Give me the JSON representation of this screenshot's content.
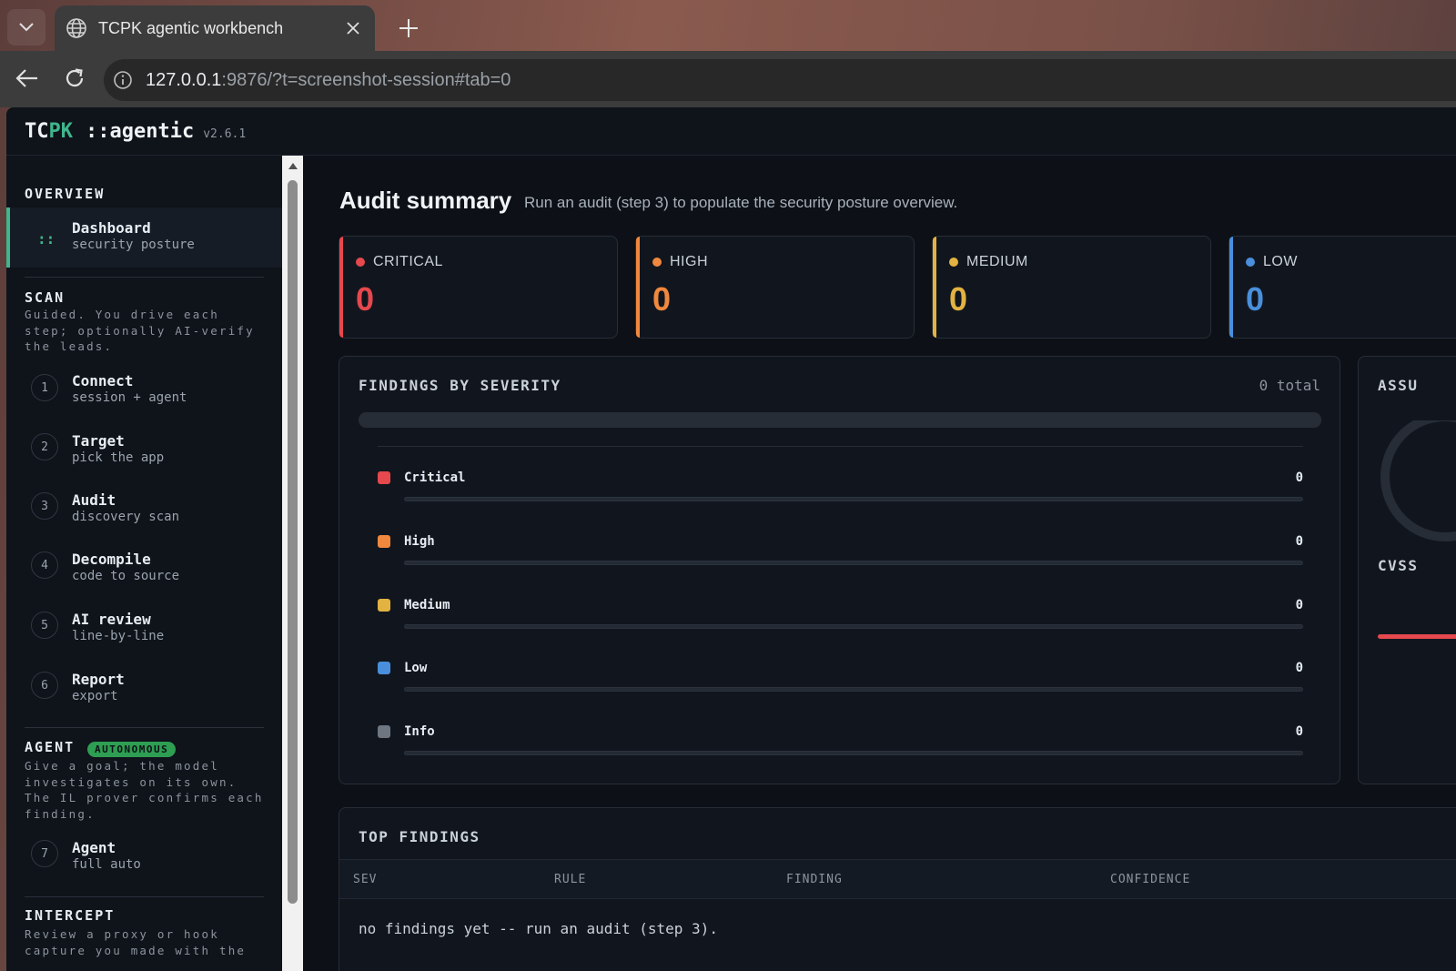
{
  "browser": {
    "tab_title": "TCPK agentic workbench",
    "url_host": "127.0.0.1",
    "url_rest": ":9876/?t=screenshot-session#tab=0"
  },
  "app": {
    "logo_tc": "TC",
    "logo_pk": "PK",
    "logo_rest": "::agentic",
    "version": "v2.6.1"
  },
  "sidebar": {
    "overview": {
      "heading": "OVERVIEW",
      "dashboard_title": "Dashboard",
      "dashboard_sub": "security posture",
      "icon": "::"
    },
    "scan": {
      "heading": "SCAN",
      "desc": "Guided. You drive each step; optionally AI-verify the leads.",
      "items": [
        {
          "num": "1",
          "title": "Connect",
          "sub": "session + agent"
        },
        {
          "num": "2",
          "title": "Target",
          "sub": "pick the app"
        },
        {
          "num": "3",
          "title": "Audit",
          "sub": "discovery scan"
        },
        {
          "num": "4",
          "title": "Decompile",
          "sub": "code to source"
        },
        {
          "num": "5",
          "title": "AI review",
          "sub": "line-by-line"
        },
        {
          "num": "6",
          "title": "Report",
          "sub": "export"
        }
      ]
    },
    "agent": {
      "heading": "AGENT",
      "badge": "AUTONOMOUS",
      "desc": "Give a goal; the model investigates on its own. The IL prover confirms each finding.",
      "item": {
        "num": "7",
        "title": "Agent",
        "sub": "full auto"
      }
    },
    "intercept": {
      "heading": "INTERCEPT",
      "desc": "Review a proxy or hook capture you made with the"
    }
  },
  "main": {
    "title": "Audit summary",
    "subtitle": "Run an audit (step 3) to populate the security posture overview.",
    "cards": [
      {
        "label": "CRITICAL",
        "count": "0",
        "color": "#e5484d"
      },
      {
        "label": "HIGH",
        "count": "0",
        "color": "#f0883e"
      },
      {
        "label": "MEDIUM",
        "count": "0",
        "color": "#e3b341"
      },
      {
        "label": "LOW",
        "count": "0",
        "color": "#4a8fdb"
      }
    ],
    "findings_by_severity": {
      "heading": "FINDINGS BY SEVERITY",
      "total": "0 total",
      "rows": [
        {
          "name": "Critical",
          "value": "0",
          "color": "#e5484d"
        },
        {
          "name": "High",
          "value": "0",
          "color": "#f0883e"
        },
        {
          "name": "Medium",
          "value": "0",
          "color": "#e3b341"
        },
        {
          "name": "Low",
          "value": "0",
          "color": "#4a8fdb"
        },
        {
          "name": "Info",
          "value": "0",
          "color": "#6e7681"
        }
      ]
    },
    "side_panel": {
      "heading": "ASSU",
      "cvss_label": "CVSS"
    },
    "top_findings": {
      "heading": "TOP FINDINGS",
      "columns": [
        "SEV",
        "RULE",
        "FINDING",
        "CONFIDENCE"
      ],
      "empty": "no findings yet -- run an audit (step 3)."
    }
  }
}
